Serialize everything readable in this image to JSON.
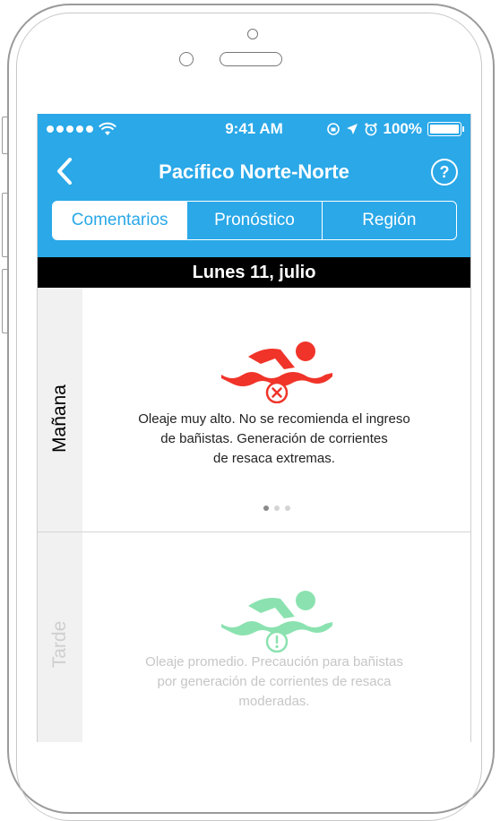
{
  "status_bar": {
    "time": "9:41 AM",
    "battery": "100%"
  },
  "nav": {
    "title": "Pacífico Norte-Norte",
    "help": "?"
  },
  "tabs": [
    {
      "label": "Comentarios",
      "active": true
    },
    {
      "label": "Pronóstico",
      "active": false
    },
    {
      "label": "Región",
      "active": false
    }
  ],
  "date": "Lunes 11, julio",
  "periods": [
    {
      "label": "Mañana",
      "icon": "swimmer-danger-icon",
      "icon_color": "#f0342a",
      "message_lines": [
        "Oleaje muy alto. No se recomienda el ingreso",
        "de bañistas. Generación de corrientes",
        "de resaca extremas."
      ],
      "page_count": 3,
      "current_page": 1
    },
    {
      "label": "Tarde",
      "icon": "swimmer-caution-icon",
      "icon_color": "#2ecc71",
      "message_lines": [
        "Oleaje promedio. Precaución para bañistas",
        "por generación de corrientes de resaca",
        "moderadas."
      ]
    }
  ],
  "colors": {
    "accent": "#2aa8e8",
    "date_bar": "#000000"
  }
}
